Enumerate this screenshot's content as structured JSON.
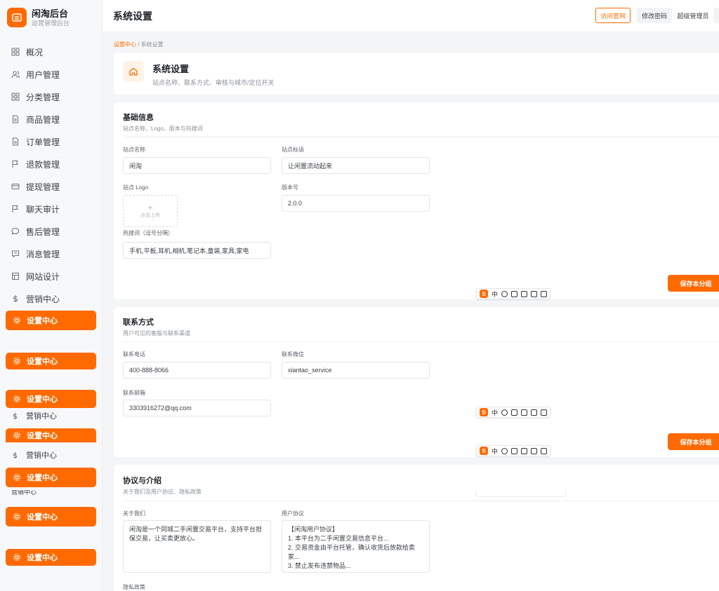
{
  "brand": {
    "title": "闲淘后台",
    "subtitle": "运营管理后台"
  },
  "sidebar": {
    "items": [
      {
        "label": "概况",
        "icon": "grid-icon"
      },
      {
        "label": "用户管理",
        "icon": "users-icon"
      },
      {
        "label": "分类管理",
        "icon": "grid-icon"
      },
      {
        "label": "商品管理",
        "icon": "file-icon"
      },
      {
        "label": "订单管理",
        "icon": "file-icon"
      },
      {
        "label": "退款管理",
        "icon": "flag-icon"
      },
      {
        "label": "提现管理",
        "icon": "card-icon"
      },
      {
        "label": "聊天审计",
        "icon": "flag-icon"
      },
      {
        "label": "售后管理",
        "icon": "chat-icon"
      },
      {
        "label": "消息管理",
        "icon": "message-icon"
      },
      {
        "label": "网站设计",
        "icon": "layout-icon"
      },
      {
        "label": "营销中心",
        "icon": "dollar-icon"
      }
    ],
    "active_label": "设置中心",
    "ghost_label": "营销中心",
    "clipped_label": "营销中心"
  },
  "header": {
    "title": "系统设置",
    "visit_site": "访问官网",
    "change_password": "修改密码",
    "user": "超级管理员"
  },
  "breadcrumb": {
    "parent": "设置中心",
    "separator": " / ",
    "current": "系统设置"
  },
  "hero": {
    "title": "系统设置",
    "subtitle": "站点名称、联系方式、审核与城市/定位开关"
  },
  "basic": {
    "title": "基础信息",
    "subtitle": "站点名称、Logo、版本与热搜词",
    "site_name_label": "站点名称",
    "site_name_value": "闲淘",
    "slogan_label": "站点标语",
    "slogan_value": "让闲置流动起来",
    "logo_label": "站点 Logo",
    "upload_text": "点击上传",
    "version_label": "版本号",
    "version_value": "2.0.0",
    "hot_label": "热搜词（逗号分隔）",
    "hot_value": "手机,平板,耳机,相机,笔记本,童装,家具,家电",
    "save": "保存本分组"
  },
  "contact": {
    "title": "联系方式",
    "subtitle": "用户可见的客服与联系渠道",
    "phone_label": "联系电话",
    "phone_value": "400-888-8066",
    "wechat_label": "联系微信",
    "wechat_value": "xiantao_service",
    "email_label": "联系邮箱",
    "email_value": "3303916272@qq.com",
    "save": "保存本分组"
  },
  "agreement": {
    "title": "协议与介绍",
    "subtitle": "关于我们及用户协议、隐私政策",
    "about_label": "关于我们",
    "about_value": "闲淘是一个同城二手闲置交易平台，支持平台担保交易，让买卖更放心。",
    "user_label": "用户协议",
    "user_value": "【闲淘用户协议】\n1. 本平台为二手闲置交易信息平台...\n2. 交易资金由平台托管，确认收货后放款给卖家...\n3. 禁止发布违禁物品...",
    "privacy_label": "隐私政策"
  },
  "ime": {
    "lang": "中",
    "logo": "S"
  },
  "colors": {
    "accent": "#ff6a00"
  }
}
